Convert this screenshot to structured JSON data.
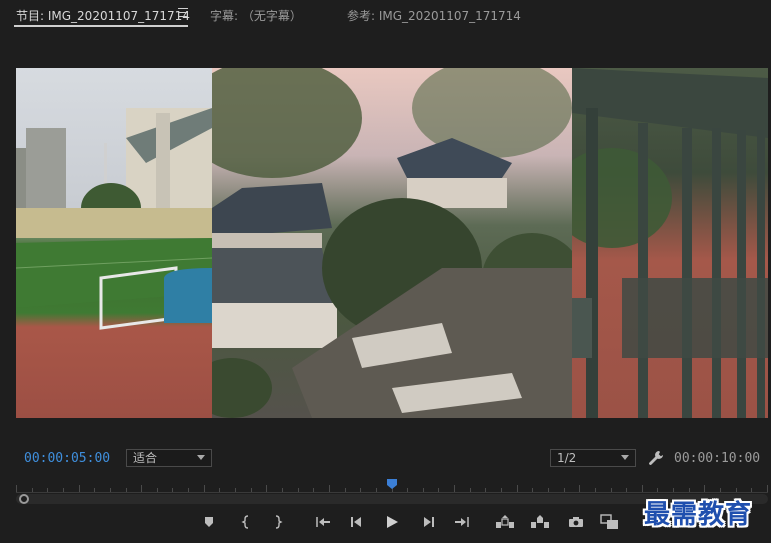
{
  "tabs": [
    {
      "label": "节目: IMG_20201107_171714",
      "active": true
    },
    {
      "label": "字幕: （无字幕）",
      "active": false
    },
    {
      "label": "参考: IMG_20201107_171714",
      "active": false
    }
  ],
  "viewer": {
    "current_timecode": "00:00:05:00",
    "fit_select": "适合",
    "resolution_select": "1/2",
    "duration_timecode": "00:00:10:00"
  },
  "playhead_fraction": 0.5,
  "transport": [
    {
      "name": "add-marker-button",
      "icon": "marker-icon"
    },
    {
      "name": "mark-in-button",
      "icon": "mark-in-icon"
    },
    {
      "name": "mark-out-button",
      "icon": "mark-out-icon"
    },
    {
      "name": "go-to-in-button",
      "icon": "go-to-in-icon"
    },
    {
      "name": "step-back-button",
      "icon": "step-back-icon"
    },
    {
      "name": "play-button",
      "icon": "play-icon"
    },
    {
      "name": "step-forward-button",
      "icon": "step-forward-icon"
    },
    {
      "name": "go-to-out-button",
      "icon": "go-to-out-icon"
    },
    {
      "name": "lift-button",
      "icon": "lift-icon"
    },
    {
      "name": "extract-button",
      "icon": "extract-icon"
    },
    {
      "name": "export-frame-button",
      "icon": "camera-icon"
    },
    {
      "name": "compare-view-button",
      "icon": "compare-icon"
    }
  ],
  "watermark": "最需教育",
  "colors": {
    "accent": "#3f8fdd",
    "background": "#1e1e1e"
  }
}
